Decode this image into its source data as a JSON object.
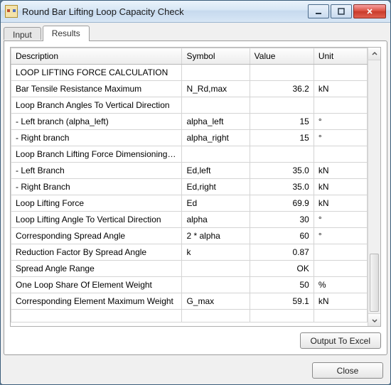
{
  "window": {
    "title": "Round Bar Lifting Loop Capacity Check"
  },
  "tabs": {
    "input": "Input",
    "results": "Results",
    "active": "results"
  },
  "columns": {
    "description": "Description",
    "symbol": "Symbol",
    "value": "Value",
    "unit": "Unit"
  },
  "rows": [
    {
      "desc": "LOOP LIFTING FORCE CALCULATION",
      "symbol": "",
      "value": "",
      "unit": ""
    },
    {
      "desc": "Bar Tensile Resistance Maximum",
      "symbol": "N_Rd,max",
      "value": "36.2",
      "unit": "kN"
    },
    {
      "desc": "Loop Branch Angles To Vertical Direction",
      "symbol": "",
      "value": "",
      "unit": ""
    },
    {
      "desc": "- Left branch (alpha_left)",
      "symbol": "alpha_left",
      "value": "15",
      "unit": "°"
    },
    {
      "desc": "- Right branch",
      "symbol": "alpha_right",
      "value": "15",
      "unit": "°"
    },
    {
      "desc": "Loop Branch Lifting Force Dimensioning Values",
      "symbol": "",
      "value": "",
      "unit": ""
    },
    {
      "desc": "- Left Branch",
      "symbol": "Ed,left",
      "value": "35.0",
      "unit": "kN"
    },
    {
      "desc": "- Right Branch",
      "symbol": "Ed,right",
      "value": "35.0",
      "unit": "kN"
    },
    {
      "desc": "Loop Lifting Force",
      "symbol": "Ed",
      "value": "69.9",
      "unit": "kN"
    },
    {
      "desc": "Loop Lifting Angle To Vertical Direction",
      "symbol": "alpha",
      "value": "30",
      "unit": "°"
    },
    {
      "desc": "Corresponding Spread Angle",
      "symbol": "2 * alpha",
      "value": "60",
      "unit": "°"
    },
    {
      "desc": "Reduction Factor By Spread Angle",
      "symbol": "k",
      "value": "0.87",
      "unit": ""
    },
    {
      "desc": "Spread Angle Range",
      "symbol": "",
      "value": "OK",
      "unit": ""
    },
    {
      "desc": "One Loop Share Of Element Weight",
      "symbol": "",
      "value": "50",
      "unit": "%"
    },
    {
      "desc": "Corresponding Element Maximum Weight",
      "symbol": "G_max",
      "value": "59.1",
      "unit": "kN"
    },
    {
      "desc": "",
      "symbol": "",
      "value": "",
      "unit": ""
    }
  ],
  "buttons": {
    "output_excel": "Output To Excel",
    "close": "Close"
  }
}
